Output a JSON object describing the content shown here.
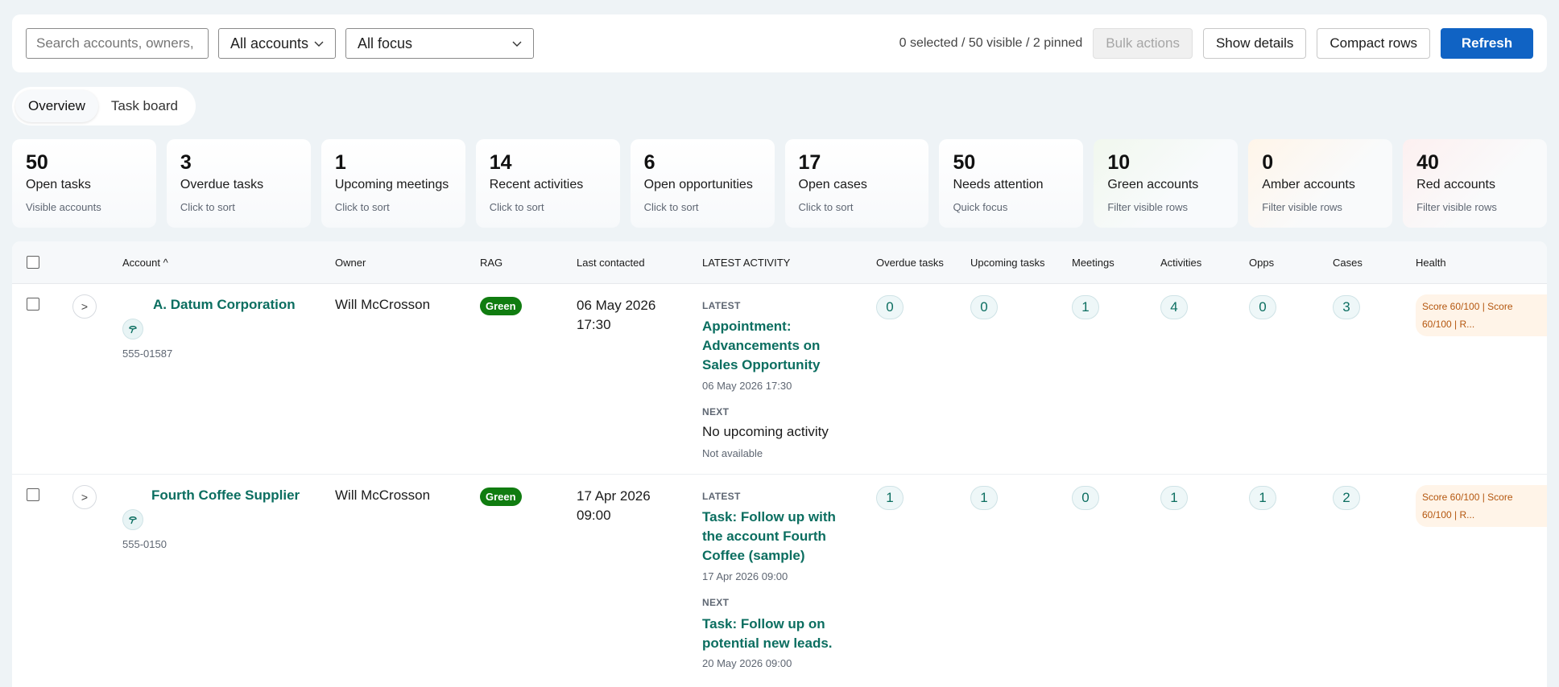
{
  "toolbar": {
    "search_placeholder": "Search accounts, owners, c",
    "account_filter": "All accounts",
    "focus_filter": "All focus",
    "selection_status": "0 selected / 50 visible / 2 pinned",
    "bulk_actions": "Bulk actions",
    "show_details": "Show details",
    "compact_rows": "Compact rows",
    "refresh": "Refresh"
  },
  "tabs": [
    {
      "label": "Overview",
      "active": true
    },
    {
      "label": "Task board",
      "active": false
    }
  ],
  "cards": [
    {
      "value": "50",
      "label": "Open tasks",
      "sub": "Visible accounts"
    },
    {
      "value": "3",
      "label": "Overdue tasks",
      "sub": "Click to sort"
    },
    {
      "value": "1",
      "label": "Upcoming meetings",
      "sub": "Click to sort"
    },
    {
      "value": "14",
      "label": "Recent activities",
      "sub": "Click to sort"
    },
    {
      "value": "6",
      "label": "Open opportunities",
      "sub": "Click to sort"
    },
    {
      "value": "17",
      "label": "Open cases",
      "sub": "Click to sort"
    },
    {
      "value": "50",
      "label": "Needs attention",
      "sub": "Quick focus"
    },
    {
      "value": "10",
      "label": "Green accounts",
      "sub": "Filter visible rows"
    },
    {
      "value": "0",
      "label": "Amber accounts",
      "sub": "Filter visible rows"
    },
    {
      "value": "40",
      "label": "Red accounts",
      "sub": "Filter visible rows"
    }
  ],
  "table": {
    "headers": {
      "account": "Account ^",
      "owner": "Owner",
      "rag": "RAG",
      "last_contacted": "Last contacted",
      "latest_activity": "LATEST ACTIVITY",
      "overdue_tasks": "Overdue tasks",
      "upcoming_tasks": "Upcoming tasks",
      "meetings": "Meetings",
      "activities": "Activities",
      "opps": "Opps",
      "cases": "Cases",
      "health": "Health"
    },
    "rows": [
      {
        "account": "A. Datum Corporation",
        "phone": "555-01587",
        "owner": "Will McCrosson",
        "rag": "Green",
        "last_contacted": "06 May 2026 17:30",
        "latest_label": "LATEST",
        "latest_title": "Appointment: Advancements on Sales Opportunity",
        "latest_date": "06 May 2026 17:30",
        "next_label": "NEXT",
        "next_title": "No upcoming activity",
        "next_date": "Not available",
        "overdue_tasks": "0",
        "upcoming_tasks": "0",
        "meetings": "1",
        "activities": "4",
        "opps": "0",
        "cases": "3",
        "health": "Score 60/100 | Score 60/100 | R..."
      },
      {
        "account": "Fourth Coffee Supplier",
        "phone": "555-0150",
        "owner": "Will McCrosson",
        "rag": "Green",
        "last_contacted": "17 Apr 2026 09:00",
        "latest_label": "LATEST",
        "latest_title": "Task: Follow up with the account Fourth Coffee (sample)",
        "latest_date": "17 Apr 2026 09:00",
        "next_label": "NEXT",
        "next_title": "Task: Follow up on potential new leads.",
        "next_date": "20 May 2026 09:00",
        "overdue_tasks": "1",
        "upcoming_tasks": "1",
        "meetings": "0",
        "activities": "1",
        "opps": "1",
        "cases": "2",
        "health": "Score 60/100 | Score 60/100 | R..."
      }
    ]
  },
  "colors": {
    "accent": "#1063c4",
    "link": "#0b6e60",
    "rag_green": "#107c10",
    "health_amber": "#b4560e"
  },
  "icons": {
    "pin": "pin-icon",
    "chevron": "chevron-down-icon",
    "expand": "expand-row-icon"
  }
}
